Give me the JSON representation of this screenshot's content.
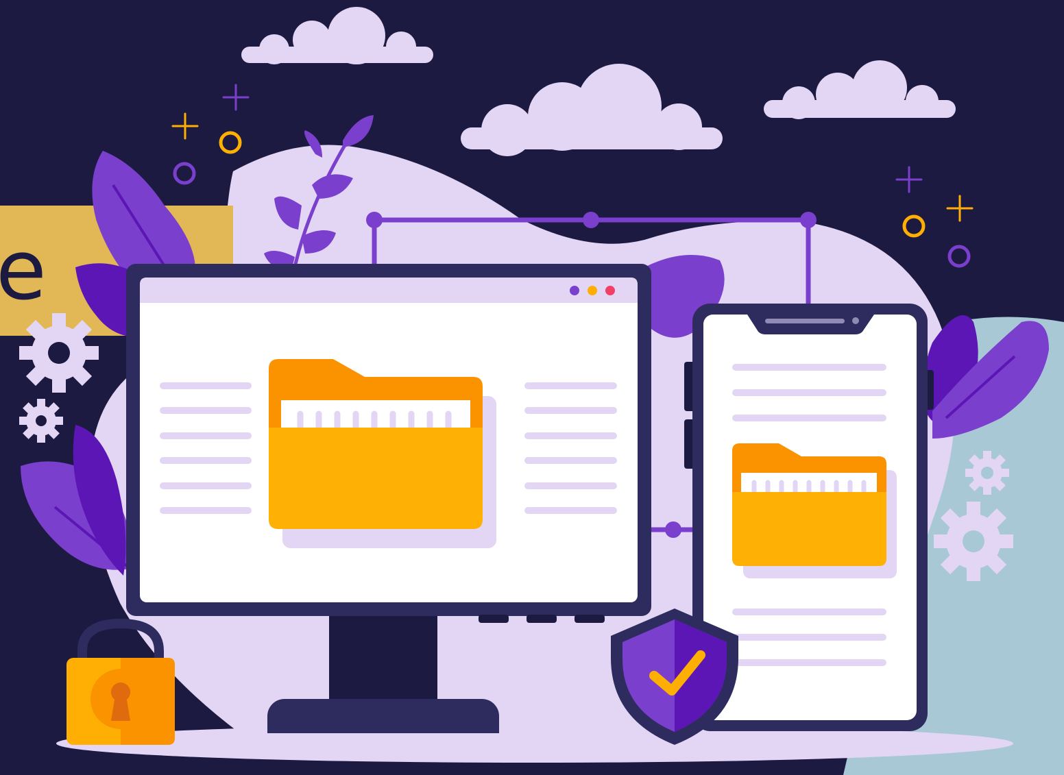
{
  "banner": {
    "text": "e"
  },
  "colors": {
    "background": "#1d1a42",
    "cloud": "#e2d6f4",
    "blob": "#e2d6f4",
    "teal_blob": "#a9c8d6",
    "banner": "#e2b857",
    "leaf_dark": "#5b16b5",
    "leaf_light": "#7a3fcc",
    "device_frame": "#2e2c5e",
    "screen": "#ffffff",
    "folder_back": "#fb9300",
    "folder_front": "#ffb004",
    "lock_body": "#ffae04",
    "shield_outer": "#2e2c5e",
    "shield_inner": "#7a3fcc",
    "check": "#ffae04",
    "dot_purple": "#7a3fcc",
    "dot_yellow": "#ffae04",
    "dot_red": "#f33f65",
    "connector": "#7a3fcc"
  },
  "icons": [
    "cloud-icon",
    "gear-icon",
    "folder-icon",
    "lock-icon",
    "shield-check-icon",
    "sparkle-icon",
    "leaf-icon"
  ]
}
